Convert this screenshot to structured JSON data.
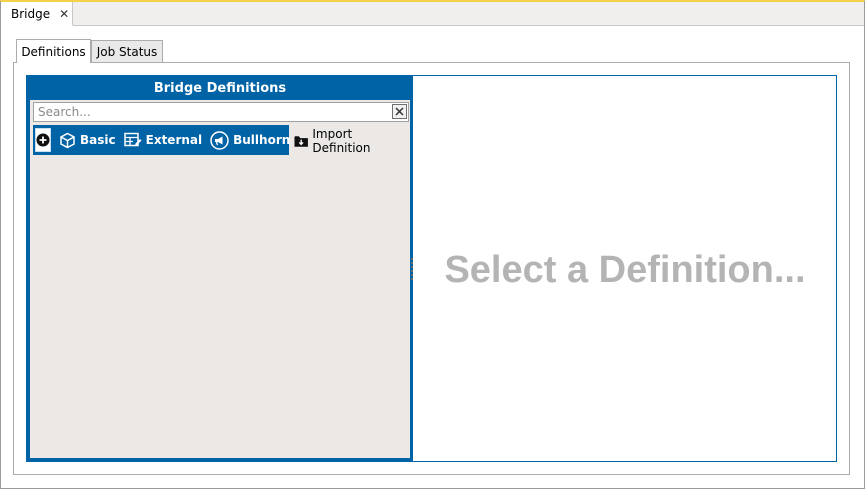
{
  "document_tab": {
    "label": "Bridge",
    "close": "✕"
  },
  "tabs": [
    {
      "label": "Definitions",
      "active": true
    },
    {
      "label": "Job Status",
      "active": false
    }
  ],
  "panel": {
    "title": "Bridge Definitions"
  },
  "search": {
    "placeholder": "Search...",
    "value": ""
  },
  "toolbar": {
    "add_icon": "plus-circle-icon",
    "basic_label": "Basic",
    "external_label": "External",
    "bullhorn_label": "Bullhorn",
    "import_label": "Import Definition"
  },
  "detail": {
    "placeholder": "Select a Definition..."
  },
  "colors": {
    "accent": "#0063a6",
    "list_bg": "#ece8e6",
    "placeholder_text": "#b4b4b4",
    "window_top": "#f3d24a"
  }
}
